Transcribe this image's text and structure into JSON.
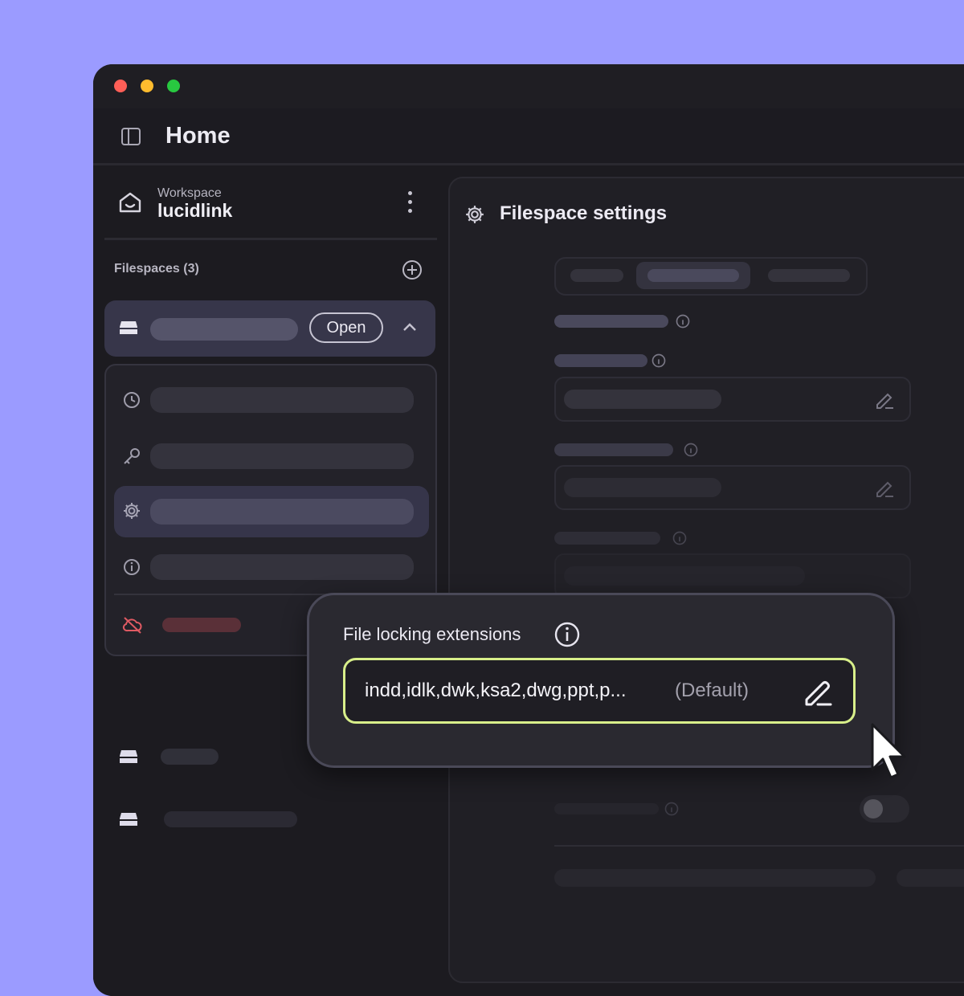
{
  "window": {
    "controls": [
      "close",
      "minimize",
      "maximize"
    ],
    "title": "Home"
  },
  "sidebar": {
    "workspace_label": "Workspace",
    "workspace_name": "lucidlink",
    "filespaces_header": "Filespaces (3)",
    "active_filespace": {
      "open_label": "Open"
    },
    "submenu_icons": [
      "clock-icon",
      "key-icon",
      "gear-icon",
      "info-icon",
      "cloud-off-icon"
    ]
  },
  "main": {
    "title": "Filespace settings"
  },
  "popover": {
    "label": "File locking extensions",
    "value": "indd,idlk,dwk,ksa2,dwg,ppt,p...",
    "default_tag": "(Default)"
  },
  "colors": {
    "background": "#9b9bff",
    "accent_border": "#d8ef8a",
    "danger": "#e05a63"
  }
}
